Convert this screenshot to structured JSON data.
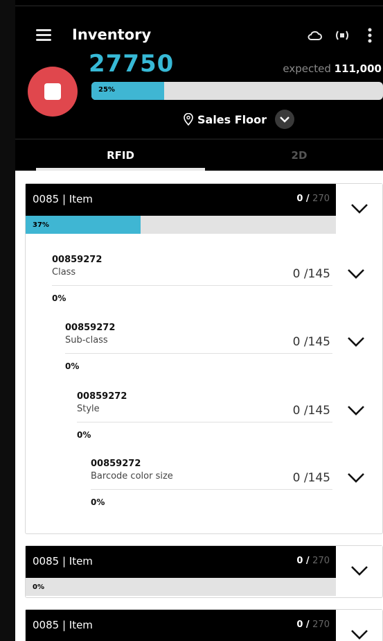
{
  "header": {
    "title": "Inventory",
    "count": "27750",
    "expected_label": "expected",
    "expected_value": "111,000",
    "progress_label": "25%",
    "progress": 0.25,
    "location": "Sales Floor"
  },
  "tabs": [
    {
      "label": "RFID",
      "active": true
    },
    {
      "label": "2D",
      "active": false
    }
  ],
  "cards": [
    {
      "name": "0085 | Item",
      "count": "0 /",
      "total": "270",
      "progress_label": "37%",
      "progress": 0.37,
      "rows": [
        {
          "code": "00859272",
          "sub": "Class",
          "qty": "0 /145",
          "pct": "0%"
        },
        {
          "code": "00859272",
          "sub": "Sub-class",
          "qty": "0 /145",
          "pct": "0%"
        },
        {
          "code": "00859272",
          "sub": "Style",
          "qty": "0 /145",
          "pct": "0%"
        },
        {
          "code": "00859272",
          "sub": "Barcode color size",
          "qty": "0 /145",
          "pct": "0%"
        }
      ]
    },
    {
      "name": "0085 | Item",
      "count": "0 /",
      "total": "270",
      "progress_label": "0%",
      "progress": 0.0
    },
    {
      "name": "0085 | Item",
      "count": "0 /",
      "total": "270"
    }
  ],
  "colors": {
    "accent": "#3fb6d3",
    "count": "#37b9d6",
    "stop": "#e0474d"
  },
  "icons": [
    "menu-icon",
    "cloud-icon",
    "rfid-reader-icon",
    "more-vertical-icon",
    "stop-icon",
    "location-pin-icon",
    "chevron-down-icon"
  ]
}
